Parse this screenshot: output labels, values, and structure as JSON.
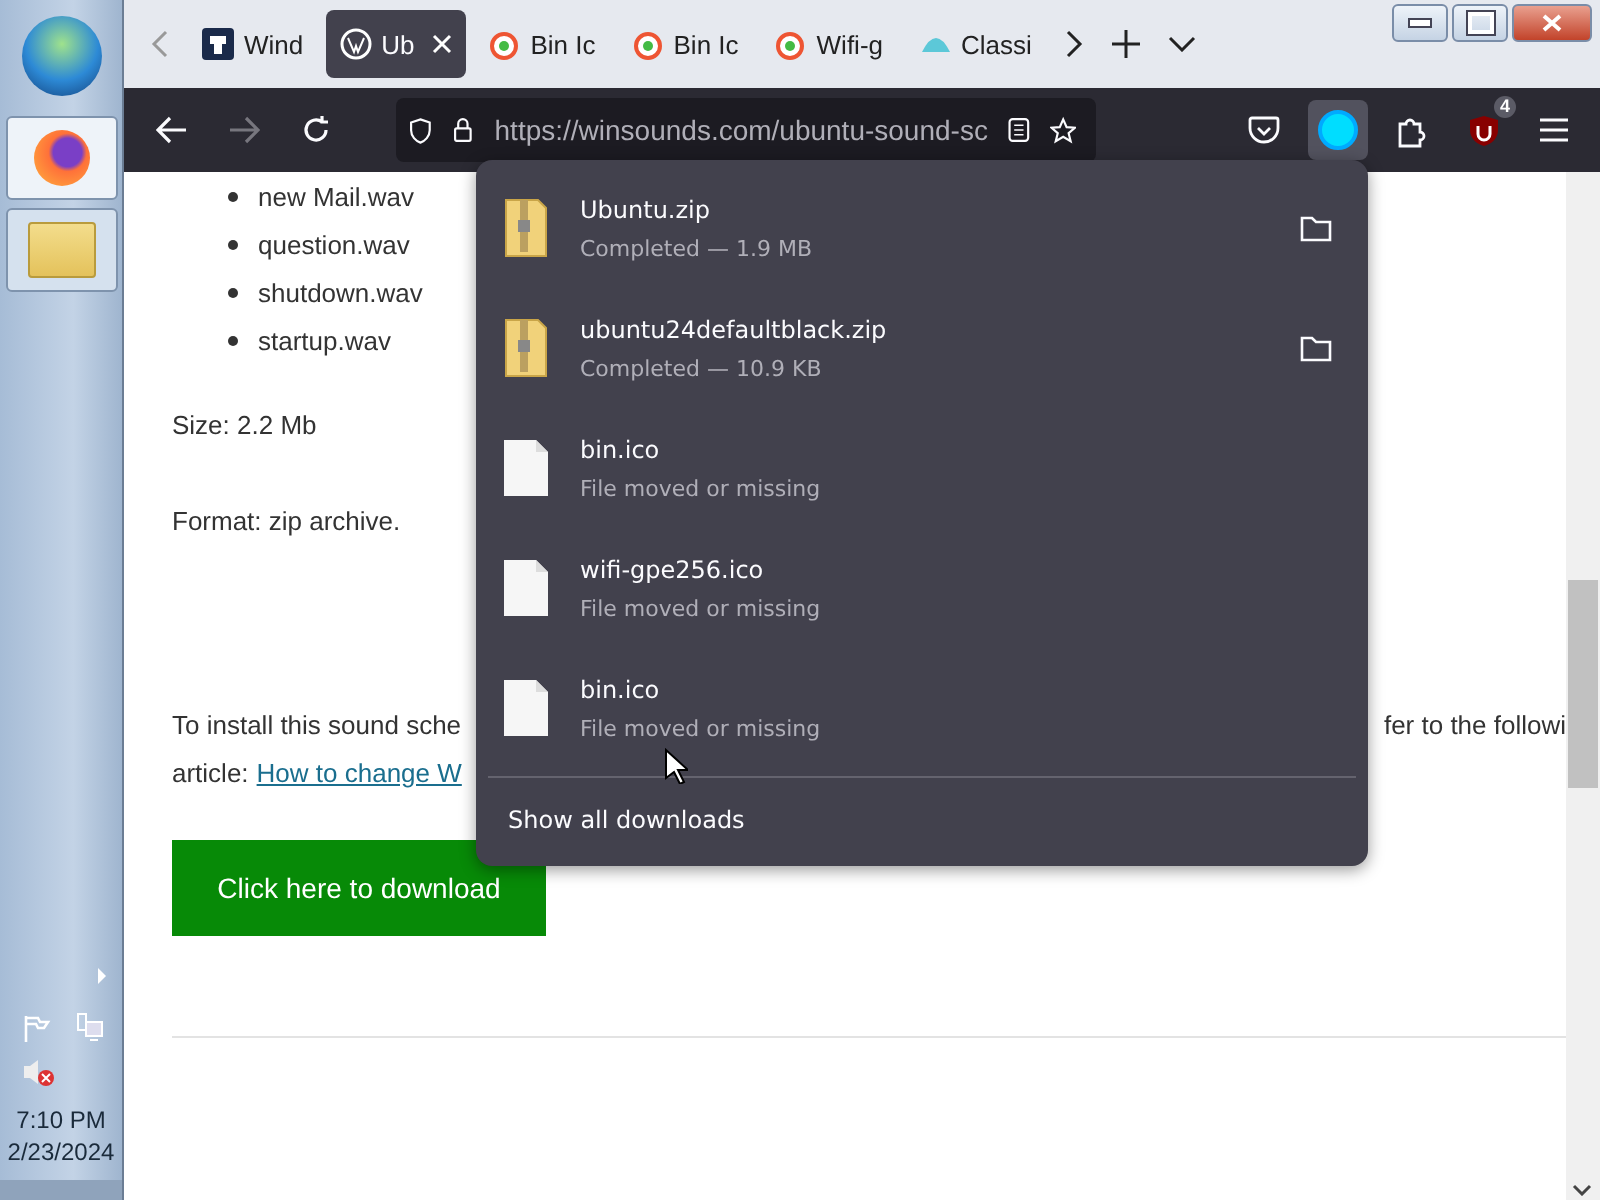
{
  "taskbar": {
    "time": "7:10 PM",
    "date": "2/23/2024",
    "volume_muted": true
  },
  "tabs": [
    {
      "label": "Wind",
      "selected": false
    },
    {
      "label": "Ub",
      "selected": true
    },
    {
      "label": "Bin Ic",
      "selected": false
    },
    {
      "label": "Bin Ic",
      "selected": false
    },
    {
      "label": "Wifi-g",
      "selected": false
    },
    {
      "label": "Classi",
      "selected": false
    }
  ],
  "toolbar": {
    "url": "https://winsounds.com/ubuntu-sound-sc",
    "forward_disabled": true,
    "ublock_badge": "4"
  },
  "page": {
    "list": [
      "new Mail.wav",
      "question.wav",
      "shutdown.wav",
      "startup.wav"
    ],
    "size": "Size: 2.2 Mb",
    "format": "Format: zip archive.",
    "install_left": "To install this sound sche",
    "install_right": "fer to the followi",
    "article_label": "article:",
    "article_link": "How to change W",
    "download_button": "Click here to download"
  },
  "downloads": {
    "items": [
      {
        "kind": "zip",
        "name": "Ubuntu.zip",
        "status": "Completed — 1.9 MB"
      },
      {
        "kind": "zip",
        "name": "ubuntu24defaultblack.zip",
        "status": "Completed — 10.9 KB"
      },
      {
        "kind": "file",
        "name": "bin.ico",
        "status": "File moved or missing"
      },
      {
        "kind": "file",
        "name": "wifi-gpe256.ico",
        "status": "File moved or missing"
      },
      {
        "kind": "file",
        "name": "bin.ico",
        "status": "File moved or missing"
      }
    ],
    "footer": "Show all downloads"
  }
}
